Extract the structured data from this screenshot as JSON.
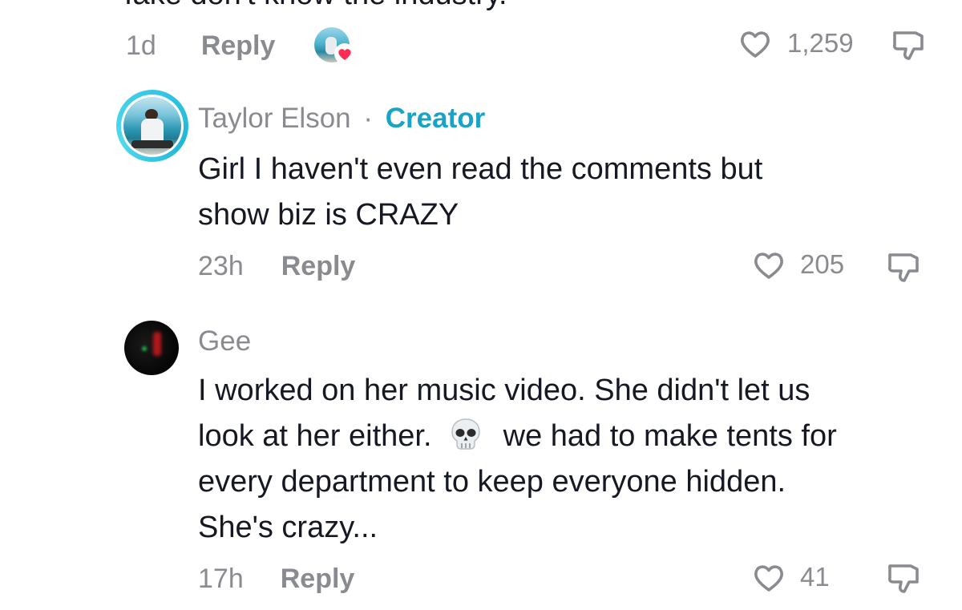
{
  "previous_comment": {
    "text_fragment": "fake don't know the industry.",
    "time": "1d",
    "reply_label": "Reply",
    "like_count": "1,259"
  },
  "comments": [
    {
      "author": "Taylor Elson",
      "separator": "·",
      "badge": "Creator",
      "line1": "Girl I haven't even read the comments but",
      "line2": "show biz is CRAZY",
      "time": "23h",
      "reply_label": "Reply",
      "like_count": "205"
    },
    {
      "author": "Gee",
      "line1": "I worked on her music video. She didn't let us",
      "line2a": "look at her either.",
      "emoji": "skull-emoji",
      "line2b": "we had to make tents for",
      "line3": "every department to keep everyone hidden.",
      "line4": "She's crazy...",
      "time": "17h",
      "reply_label": "Reply",
      "like_count": "41"
    }
  ],
  "colors": {
    "text": "#161823",
    "muted": "#8a8b91",
    "creator": "#1aa3c8",
    "heart_badge": "#fe2c55"
  },
  "icons": [
    "heart-outline-icon",
    "dislike-icon",
    "skull-emoji"
  ]
}
